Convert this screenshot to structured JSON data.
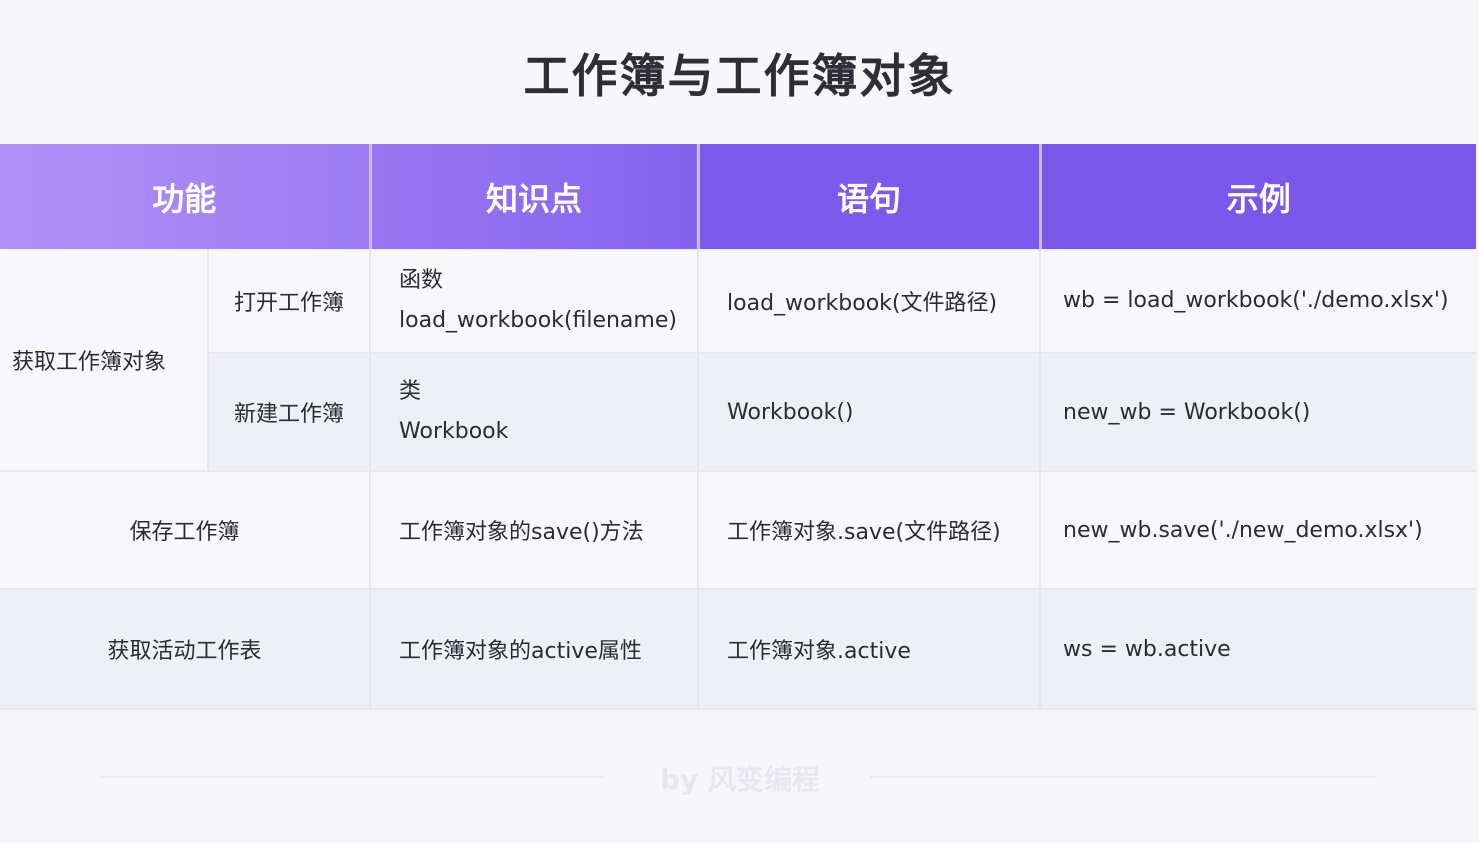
{
  "title": "工作簿与工作簿对象",
  "header": [
    "功能",
    "知识点",
    "语句",
    "示例"
  ],
  "rows": {
    "group_label": "获取工作簿对象",
    "open": {
      "feature": "打开工作簿",
      "knowledge_line1": "函数",
      "knowledge_line2": "load_workbook(filename)",
      "statement": "load_workbook(文件路径)",
      "example": "wb = load_workbook('./demo.xlsx')"
    },
    "new": {
      "feature": "新建工作簿",
      "knowledge_line1": "类",
      "knowledge_line2": "Workbook",
      "statement": "Workbook()",
      "example": "new_wb = Workbook()"
    },
    "save": {
      "feature": "保存工作簿",
      "knowledge": "工作簿对象的save()方法",
      "statement": "工作簿对象.save(文件路径)",
      "example": "new_wb.save('./new_demo.xlsx')"
    },
    "active": {
      "feature": "获取活动工作表",
      "knowledge": "工作簿对象的active属性",
      "statement": "工作簿对象.active",
      "example": "ws = wb.active"
    }
  },
  "footer": {
    "credit": "by 风变编程"
  }
}
